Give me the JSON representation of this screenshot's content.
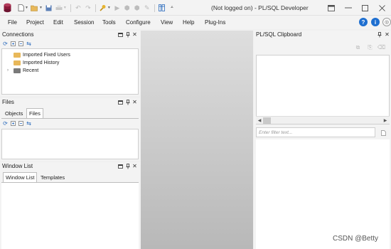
{
  "window": {
    "title": "(Not logged on) - PL/SQL Developer"
  },
  "quick_access": {
    "icons": [
      "new-icon",
      "open-icon",
      "save-icon",
      "print-icon",
      "undo-icon",
      "redo-icon",
      "find-icon",
      "execute-icon",
      "break-icon",
      "stop-icon",
      "debug-icon",
      "layout-icon",
      "customize-icon"
    ]
  },
  "menu": {
    "items": [
      "File",
      "Project",
      "Edit",
      "Session",
      "Tools",
      "Configure",
      "View",
      "Help",
      "Plug-Ins"
    ]
  },
  "connections": {
    "title": "Connections",
    "tree": [
      {
        "label": "Imported Fixed Users",
        "icon": "folder-icon",
        "expandable": false
      },
      {
        "label": "Imported History",
        "icon": "folder-icon",
        "expandable": false
      },
      {
        "label": "Recent",
        "icon": "folder-icon",
        "expandable": true
      }
    ]
  },
  "files": {
    "title": "Files",
    "tabs": [
      "Objects",
      "Files"
    ],
    "active_tab": "Files"
  },
  "window_list": {
    "title": "Window List",
    "tabs": [
      "Window List",
      "Templates"
    ],
    "active_tab": "Window List"
  },
  "clipboard": {
    "title": "PL/SQL Clipboard",
    "filter_placeholder": "Enter filter text..."
  },
  "watermark": "CSDN @Betty",
  "colors": {
    "app_icon": "#8b1a3a",
    "help_blue": "#1e6fd0",
    "info_blue": "#1e6fd0",
    "folder": "#e8b85a",
    "toolbar_blue": "#2a6bbd"
  }
}
